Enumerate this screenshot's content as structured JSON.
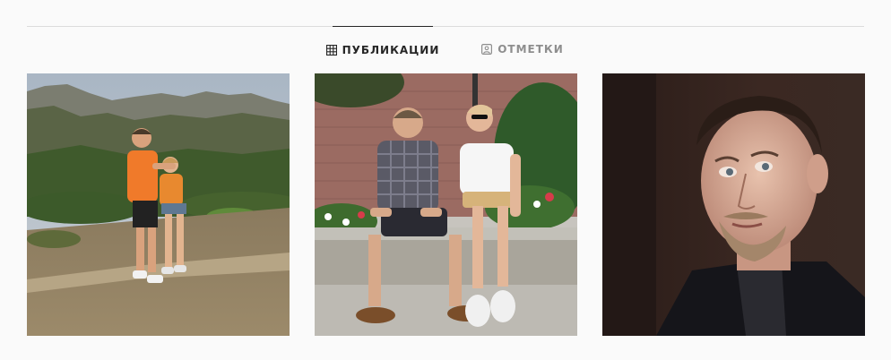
{
  "tabs": {
    "posts_label": "ПУБЛИКАЦИИ",
    "tagged_label": "ОТМЕТКИ",
    "posts_icon": "grid-icon",
    "tagged_icon": "tagged-icon",
    "active_color": "#262626",
    "inactive_color": "#8e8e8e"
  },
  "posts": [
    {
      "subject": "couple-on-mountain-trail-photo"
    },
    {
      "subject": "couple-sitting-on-bench-photo"
    },
    {
      "subject": "young-man-portrait-photo"
    }
  ]
}
